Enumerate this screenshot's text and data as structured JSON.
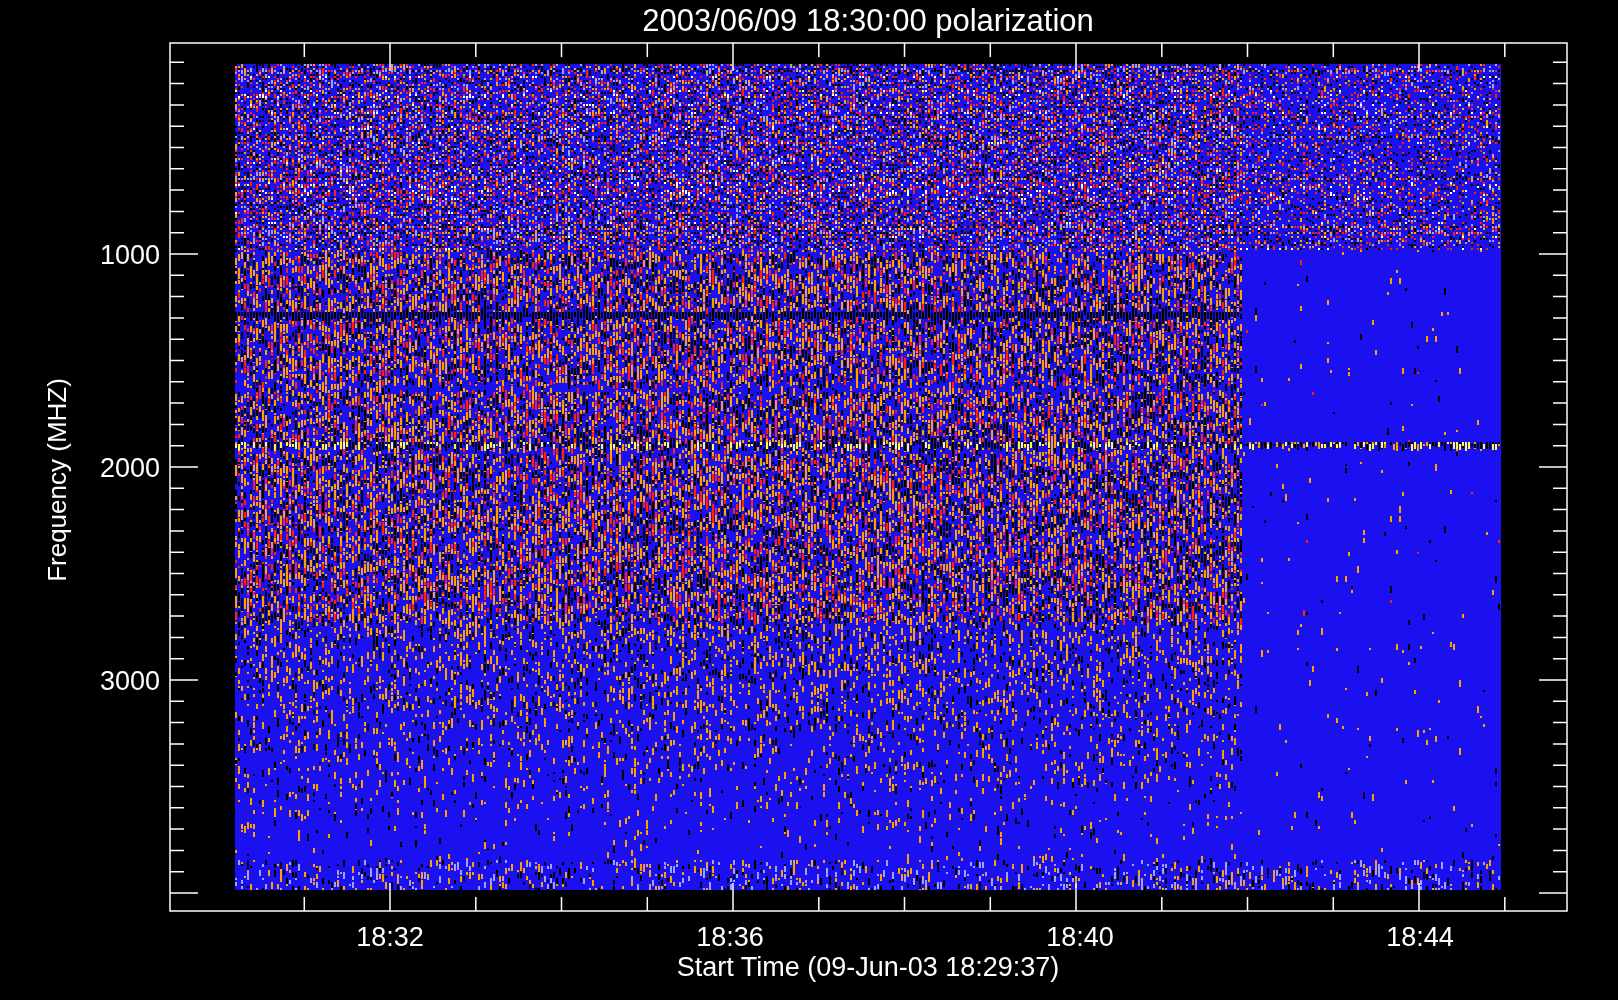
{
  "title": "2003/06/09 18:30:00 polarization",
  "y_axis": {
    "label": "Frequency (MHZ)",
    "ticks": [
      "1000",
      "2000",
      "3000"
    ]
  },
  "x_axis": {
    "label": "Start Time (09-Jun-03 18:29:37)",
    "ticks": [
      "18:32",
      "18:36",
      "18:40",
      "18:44"
    ]
  }
}
